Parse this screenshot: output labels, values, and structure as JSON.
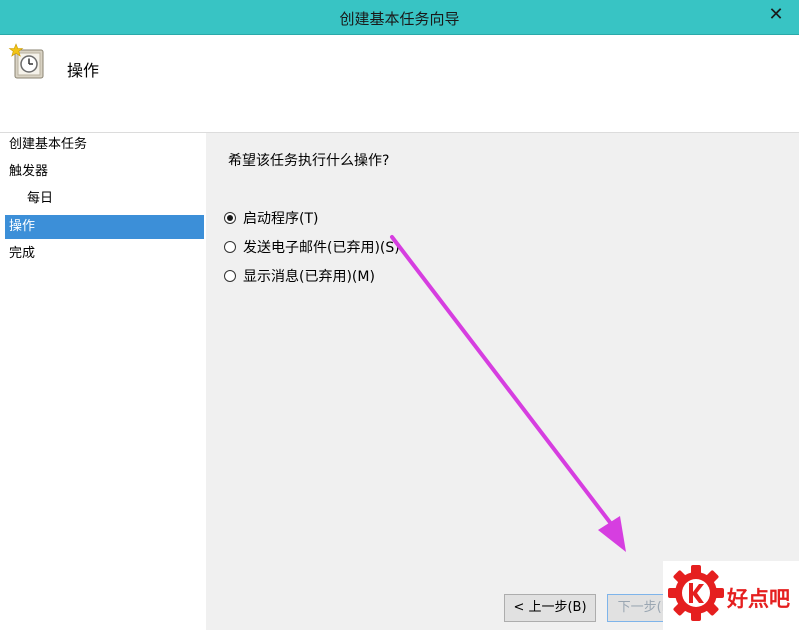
{
  "window": {
    "title": "创建基本任务向导",
    "close_glyph": "✕"
  },
  "header": {
    "heading": "操作",
    "icon": "scheduled-task-clock-icon"
  },
  "sidebar": {
    "steps": [
      {
        "label": "创建基本任务",
        "active": false
      },
      {
        "label": "触发器",
        "active": false
      },
      {
        "label": "每日",
        "active": false
      },
      {
        "label": "操作",
        "active": true
      },
      {
        "label": "完成",
        "active": false
      }
    ]
  },
  "content": {
    "question": "希望该任务执行什么操作?",
    "options": [
      {
        "label": "启动程序(T)",
        "checked": true
      },
      {
        "label": "发送电子邮件(已弃用)(S)",
        "checked": false
      },
      {
        "label": "显示消息(已弃用)(M)",
        "checked": false
      }
    ]
  },
  "buttons": {
    "back_label": "< 上一步(B)",
    "next_label": "下一步(N)"
  },
  "watermark": {
    "text": "好点吧",
    "color": "#e51f1f"
  },
  "annotation": {
    "arrow_color": "#d63ee0"
  }
}
